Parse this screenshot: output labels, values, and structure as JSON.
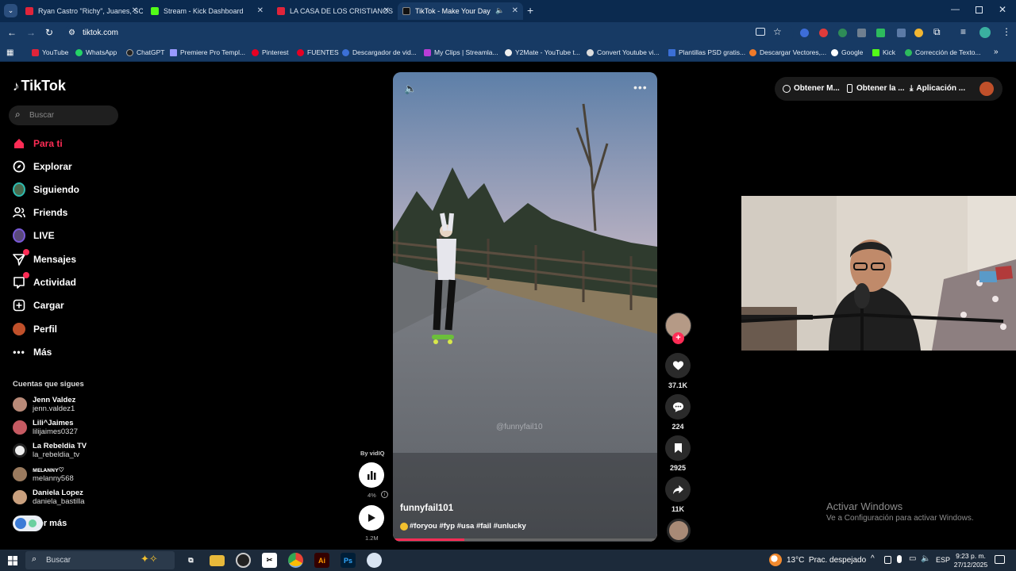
{
  "browser": {
    "tabs": [
      {
        "title": "Ryan Castro \"Richy\", Juanes, SC",
        "color": "#e0243a"
      },
      {
        "title": "Stream - Kick Dashboard",
        "color": "#53fc18"
      },
      {
        "title": "LA CASA DE LOS CRISTIANOS",
        "color": "#e0243a"
      },
      {
        "title": "TikTok - Make Your Day",
        "color": "#111111"
      }
    ],
    "url": "tiktok.com",
    "bookmarks": [
      "YouTube",
      "WhatsApp",
      "ChatGPT",
      "Premiere Pro Templ...",
      "Pinterest",
      "FUENTES",
      "Descargador de vid...",
      "My Clips | Streamla...",
      "Y2Mate - YouTube t...",
      "Convert Youtube vi...",
      "Plantillas PSD gratis...",
      "Descargar Vectores,...",
      "Google",
      "Kick",
      "Corrección de Texto..."
    ]
  },
  "tiktok": {
    "logo": "TikTok",
    "search_placeholder": "Buscar",
    "nav": [
      {
        "label": "Para ti",
        "icon": "home-icon"
      },
      {
        "label": "Explorar",
        "icon": "compass-icon"
      },
      {
        "label": "Siguiendo",
        "icon": "following-avatar-icon"
      },
      {
        "label": "Friends",
        "icon": "friends-icon"
      },
      {
        "label": "LIVE",
        "icon": "live-avatar-icon"
      },
      {
        "label": "Mensajes",
        "icon": "send-icon"
      },
      {
        "label": "Actividad",
        "icon": "activity-icon"
      },
      {
        "label": "Cargar",
        "icon": "plus-square-icon"
      },
      {
        "label": "Perfil",
        "icon": "profile-avatar-icon"
      },
      {
        "label": "Más",
        "icon": "more-dots-icon"
      }
    ],
    "following_title": "Cuentas que sigues",
    "following": [
      {
        "name": "Jenn Valdez",
        "handle": "jenn.valdez1"
      },
      {
        "name": "Lili^Jaimes",
        "handle": "lilijaimes0327"
      },
      {
        "name": "La Rebeldia TV",
        "handle": "la_rebeldia_tv"
      },
      {
        "name": "ᴍᴇʟᴀɴɴʏ♡",
        "handle": "melanny568"
      },
      {
        "name": "Daniela Lopez",
        "handle": "daniela_bastilla"
      }
    ],
    "see_more": "Ver más",
    "top_buttons": [
      "Obtener M...",
      "Obtener la ...",
      "Aplicación ..."
    ],
    "video": {
      "username": "funnyfail101",
      "caption": "#foryou #fyp #usa #fail #unlucky",
      "watermark": "@funnyfail10",
      "progress": 0.27
    },
    "actions": {
      "likes": "37.1K",
      "comments": "224",
      "saves": "2925",
      "shares": "11K"
    },
    "vidiq": {
      "label": "By vidIQ",
      "percent": "4%",
      "views": "1.2M"
    }
  },
  "windows": {
    "activate_title": "Activar Windows",
    "activate_sub": "Ve a Configuración para activar Windows.",
    "search_placeholder": "Buscar",
    "weather": "13°C  Prac. despejado",
    "lang": "ESP",
    "time": "9:23 p. m.",
    "date": "27/12/2025"
  }
}
